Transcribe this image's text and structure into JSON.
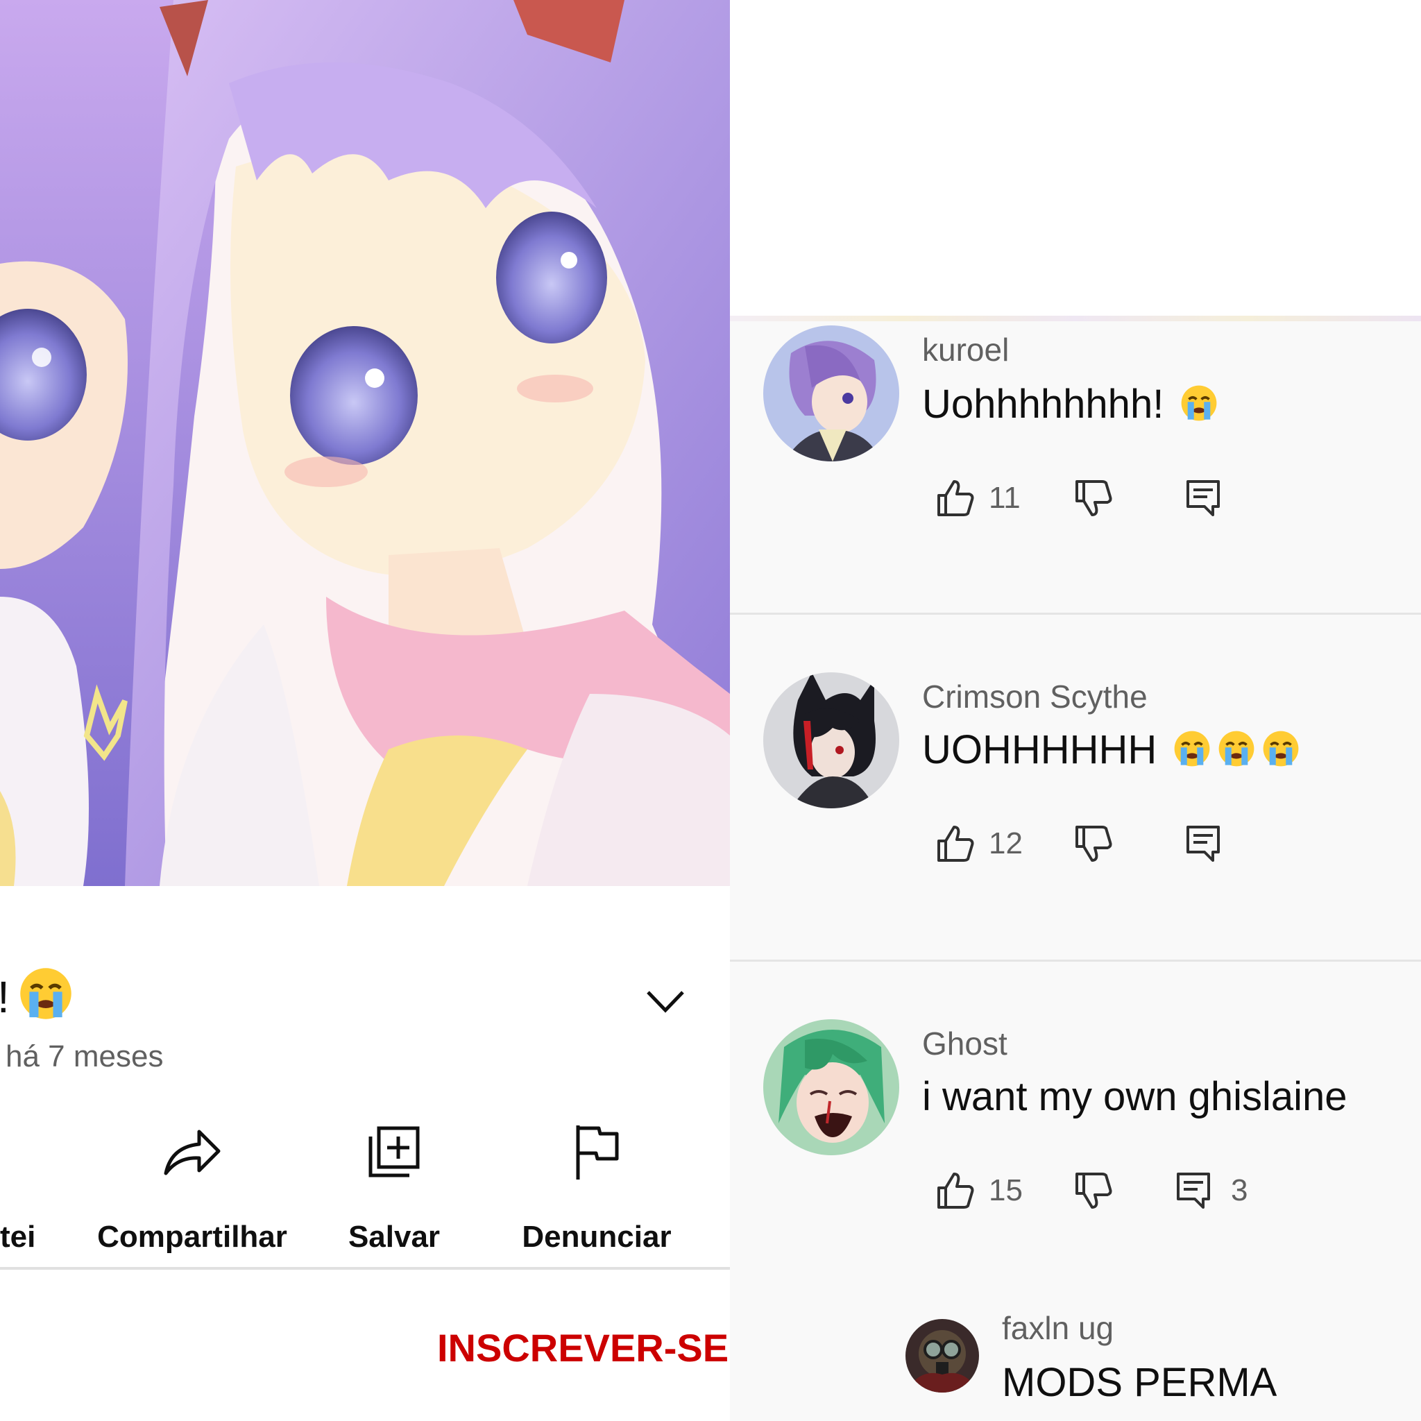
{
  "video": {
    "title_visible_fragment": "!",
    "meta": "há 7 meses",
    "actions": [
      {
        "label": "ostei",
        "icon": "dislike-icon"
      },
      {
        "label": "Compartilhar",
        "icon": "share-icon"
      },
      {
        "label": "Salvar",
        "icon": "save-icon"
      },
      {
        "label": "Denunciar",
        "icon": "flag-icon"
      }
    ],
    "subscribe_label": "INSCREVER-SE"
  },
  "comments": [
    {
      "author": "kuroel",
      "text": "Uohhhhhhhh!",
      "emoji_count": 1,
      "likes": "11",
      "replies": ""
    },
    {
      "author": "Crimson Scythe",
      "text": "UOHHHHHH",
      "emoji_count": 3,
      "likes": "12",
      "replies": ""
    },
    {
      "author": "Ghost",
      "text": "i want my own ghislaine",
      "emoji_count": 0,
      "likes": "15",
      "replies": "3"
    },
    {
      "author": "faxln ug",
      "text": "MODS PERMA"
    }
  ],
  "colors": {
    "subscribe": "#cc0000",
    "secondary_text": "#606060",
    "primary_text": "#0f0f0f",
    "comments_bg": "#f9f9f9"
  }
}
